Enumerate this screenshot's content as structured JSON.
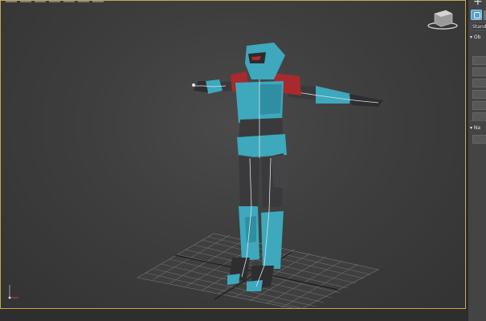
{
  "app": {
    "name": "3D viewport"
  },
  "panel": {
    "plus_label": "+",
    "field_text": "Stand",
    "rollouts": [
      {
        "label": "▾ Ob"
      },
      {
        "label": "▾ Na"
      }
    ]
  },
  "viewcube": {
    "icon": "viewcube-icon"
  },
  "axis_gizmo": {
    "icon": "axis-gizmo-icon"
  },
  "colors": {
    "viewport_border": "#c9a84a",
    "armor_cyan": "#3ea8bd",
    "armor_dark": "#3a3a3c",
    "armor_red": "#a82a2c",
    "grid": "#6a6a6a"
  }
}
